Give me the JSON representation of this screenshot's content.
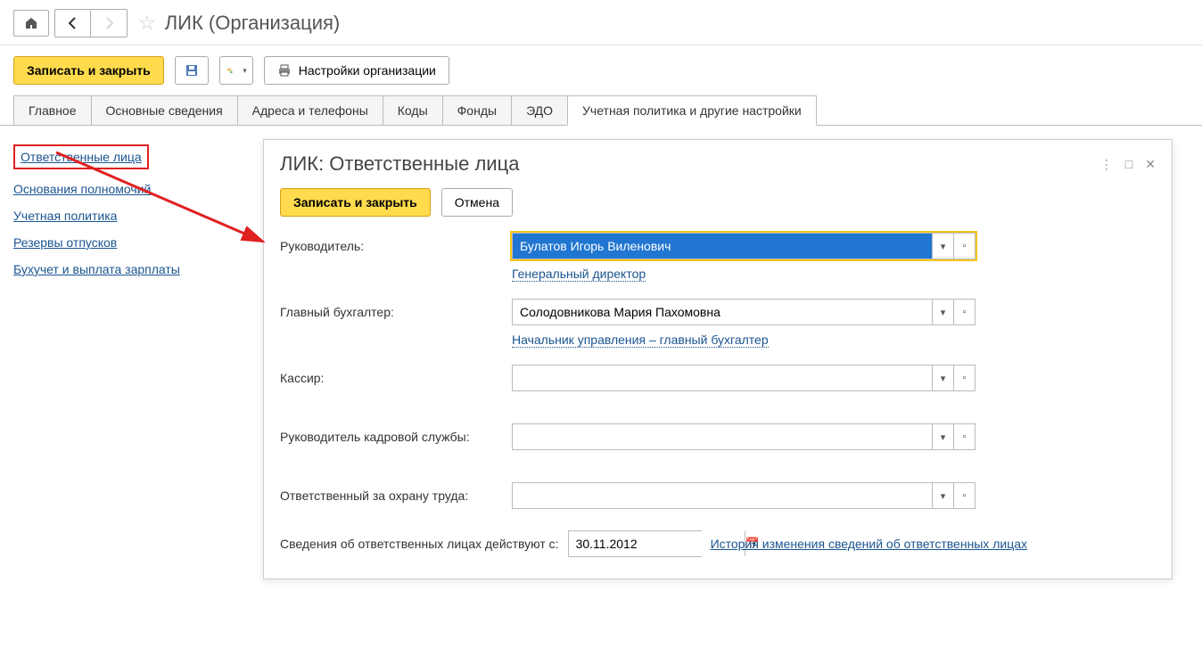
{
  "header": {
    "title": "ЛИК (Организация)"
  },
  "toolbar": {
    "save_close": "Записать и закрыть",
    "settings_org": "Настройки организации"
  },
  "tabs": [
    "Главное",
    "Основные сведения",
    "Адреса и телефоны",
    "Коды",
    "Фонды",
    "ЭДО",
    "Учетная политика и другие настройки"
  ],
  "sidebar": {
    "items": [
      "Ответственные лица",
      "Основания полномочий",
      "Учетная политика",
      "Резервы отпусков",
      "Бухучет и выплата зарплаты"
    ]
  },
  "panel": {
    "title": "ЛИК: Ответственные лица",
    "save_close": "Записать и закрыть",
    "cancel": "Отмена",
    "fields": {
      "leader": {
        "label": "Руководитель:",
        "value": "Булатов Игорь Виленович",
        "position": "Генеральный директор"
      },
      "chief_accountant": {
        "label": "Главный бухгалтер:",
        "value": "Солодовникова Мария Пахомовна",
        "position": "Начальник управления – главный бухгалтер"
      },
      "cashier": {
        "label": "Кассир:",
        "value": ""
      },
      "hr_head": {
        "label": "Руководитель кадровой службы:",
        "value": ""
      },
      "safety_head": {
        "label": "Ответственный за охрану труда:",
        "value": ""
      }
    },
    "footer": {
      "effective_label": "Сведения об ответственных лицах действуют с:",
      "date": "30.11.2012",
      "history_link": "История изменения сведений об ответственных лицах"
    }
  }
}
